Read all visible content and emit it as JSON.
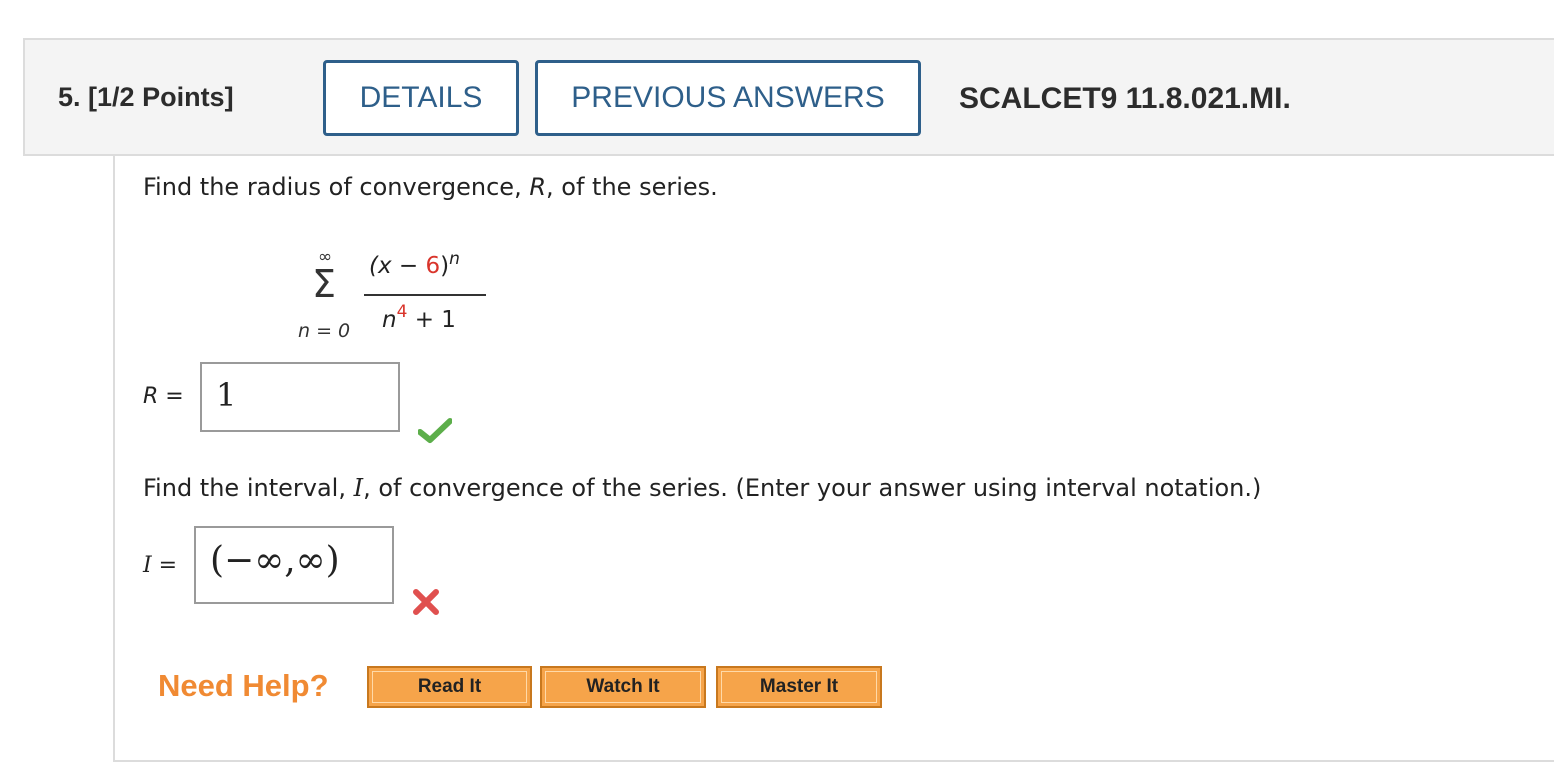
{
  "header": {
    "question_number": "5.",
    "points": "[1/2 Points]",
    "details_label": "DETAILS",
    "previous_answers_label": "PREVIOUS ANSWERS",
    "assignment_id": "SCALCET9 11.8.021.MI."
  },
  "question": {
    "prompt1_before": "Find the radius of convergence, ",
    "prompt1_var": "R",
    "prompt1_after": ", of the series.",
    "series": {
      "sum_upper": "∞",
      "sum_lower": "n = 0",
      "numer_open": "(x − ",
      "numer_const": "6",
      "numer_close": ")",
      "numer_exp": "n",
      "denom_base": "n",
      "denom_exp": "4",
      "denom_rest": " + 1"
    },
    "r_label": "R =",
    "r_answer": "1",
    "r_status": "correct",
    "prompt2_before": "Find the interval, ",
    "prompt2_var": "I",
    "prompt2_after": ", of convergence of the series. (Enter your answer using interval notation.)",
    "i_label": "I =",
    "i_answer": "(−∞,∞)",
    "i_status": "incorrect"
  },
  "help": {
    "label": "Need Help?",
    "buttons": [
      "Read It",
      "Watch It",
      "Master It"
    ]
  },
  "colors": {
    "accent_blue": "#2e5f8a",
    "highlight_red": "#d9342b",
    "help_orange": "#f08a33",
    "check_green": "#5cae4a",
    "cross_red": "#e0504f"
  }
}
